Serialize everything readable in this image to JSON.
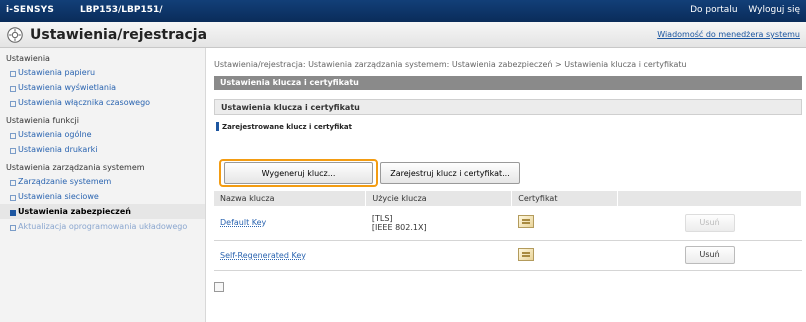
{
  "topbar": {
    "brand": "i-SENSYS",
    "model": "LBP153/LBP151/",
    "links": [
      "Do portalu",
      "Wyloguj się"
    ]
  },
  "header": {
    "title": "Ustawienia/rejestracja",
    "message_link": "Wiadomość do menedżera systemu"
  },
  "sidebar": {
    "sections": [
      {
        "label": "Ustawienia",
        "items": [
          "Ustawienia papieru",
          "Ustawienia wyświetlania",
          "Ustawienia włącznika czasowego"
        ]
      },
      {
        "label": "Ustawienia funkcji",
        "items": [
          "Ustawienia ogólne",
          "Ustawienia drukarki"
        ]
      },
      {
        "label": "Ustawienia zarządzania systemem",
        "items": [
          "Zarządzanie systemem",
          "Ustawienia sieciowe",
          "Ustawienia zabezpieczeń",
          "Aktualizacja oprogramowania układowego"
        ]
      }
    ]
  },
  "main": {
    "breadcrumb": "Ustawienia/rejestracja: Ustawienia zarządzania systemem: Ustawienia zabezpieczeń > Ustawienia klucza i certyfikatu",
    "section_header": "Ustawienia klucza i certyfikatu",
    "subsection_header": "Ustawienia klucza i certyfikatu",
    "registered_title": "Zarejestrowane klucz i certyfikat",
    "buttons": {
      "generate": "Wygeneruj klucz...",
      "register": "Zarejestruj klucz i certyfikat..."
    },
    "table": {
      "headers": [
        "Nazwa klucza",
        "Użycie klucza",
        "Certyfikat",
        ""
      ],
      "rows": [
        {
          "name": "Default Key",
          "usage_1": "[TLS]",
          "usage_2": "[IEEE 802.1X]",
          "delete": "Usuń"
        },
        {
          "name": "Self-Regenerated Key",
          "usage_1": "",
          "usage_2": "",
          "delete": "Usuń"
        }
      ]
    }
  },
  "colors": {
    "highlight": "#f39c12",
    "topbar": "#123f78",
    "link": "#2a64b0"
  }
}
